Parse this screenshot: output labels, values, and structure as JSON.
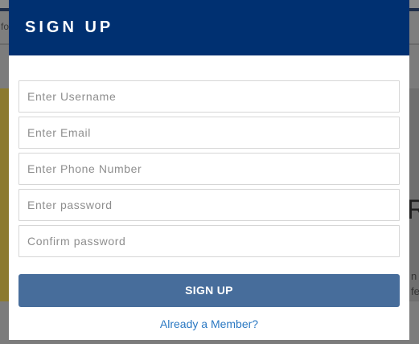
{
  "background": {
    "search_fragment": "fo",
    "hero_letter": "R",
    "hero_text_line1": "n",
    "hero_text_line2": "fe"
  },
  "modal": {
    "title": "SIGN UP",
    "fields": {
      "username": {
        "placeholder": "Enter Username"
      },
      "email": {
        "placeholder": "Enter Email"
      },
      "phone": {
        "placeholder": "Enter Phone Number"
      },
      "password": {
        "placeholder": "Enter password"
      },
      "confirm_password": {
        "placeholder": "Confirm password"
      }
    },
    "submit_label": "SIGN UP",
    "member_link": "Already a Member?"
  },
  "colors": {
    "header": "#003071",
    "button": "#476d9b",
    "link": "#2a78c2"
  }
}
